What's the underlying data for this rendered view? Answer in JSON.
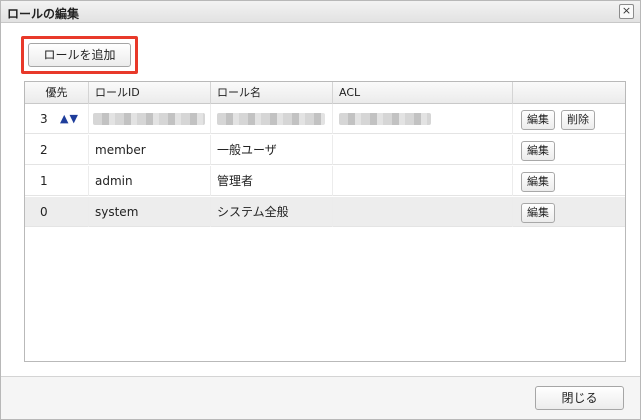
{
  "dialog": {
    "title": "ロールの編集",
    "close_icon": "×"
  },
  "toolbar": {
    "add_role_label": "ロールを追加"
  },
  "table": {
    "columns": [
      "優先",
      "ロールID",
      "ロール名",
      "ACL",
      ""
    ],
    "rows": [
      {
        "priority": "3",
        "arrows": "▲▼",
        "role_id": "",
        "role_name": "",
        "acl": "",
        "edit": "編集",
        "delete": "削除"
      },
      {
        "priority": "2",
        "role_id": "member",
        "role_name": "一般ユーザ",
        "acl": "",
        "edit": "編集"
      },
      {
        "priority": "1",
        "role_id": "admin",
        "role_name": "管理者",
        "acl": "",
        "edit": "編集"
      },
      {
        "priority": "0",
        "role_id": "system",
        "role_name": "システム全般",
        "acl": "",
        "edit": "編集"
      }
    ]
  },
  "footer": {
    "close_label": "閉じる"
  },
  "colors": {
    "highlight": "#e8392a",
    "arrow": "#1e3d9b",
    "selected_row": "#ededed"
  }
}
